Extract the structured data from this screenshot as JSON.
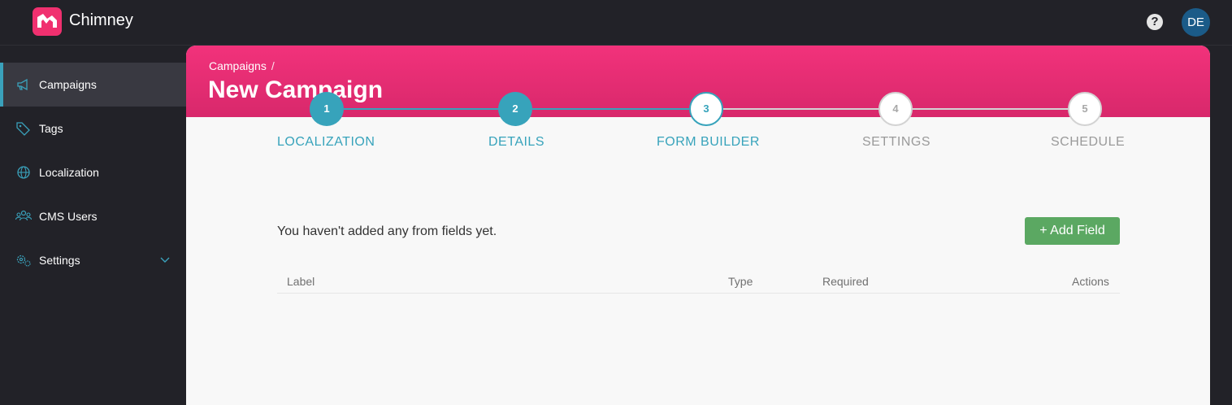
{
  "app": {
    "name": "Chimney",
    "avatar_initials": "DE",
    "help_icon": "?"
  },
  "colors": {
    "accent": "#37a3bb",
    "brand": "#f0306f",
    "success": "#5ba862",
    "sidebar_bg": "#222228"
  },
  "sidebar": {
    "items": [
      {
        "label": "Campaigns",
        "icon": "megaphone-icon",
        "active": true
      },
      {
        "label": "Tags",
        "icon": "tag-icon"
      },
      {
        "label": "Localization",
        "icon": "globe-icon"
      },
      {
        "label": "CMS Users",
        "icon": "users-icon"
      },
      {
        "label": "Settings",
        "icon": "gears-icon",
        "expandable": true
      }
    ]
  },
  "header": {
    "breadcrumb": "Campaigns",
    "breadcrumb_sep": "/",
    "title": "New Campaign"
  },
  "stepper": {
    "steps": [
      {
        "number": "1",
        "label": "LOCALIZATION",
        "state": "done"
      },
      {
        "number": "2",
        "label": "DETAILS",
        "state": "done"
      },
      {
        "number": "3",
        "label": "FORM BUILDER",
        "state": "current"
      },
      {
        "number": "4",
        "label": "SETTINGS",
        "state": "todo"
      },
      {
        "number": "5",
        "label": "SCHEDULE",
        "state": "todo"
      }
    ]
  },
  "form_builder": {
    "empty_message": "You haven't added any from fields yet.",
    "add_button": "+ Add Field",
    "columns": [
      "Label",
      "Type",
      "Required",
      "Actions"
    ]
  }
}
